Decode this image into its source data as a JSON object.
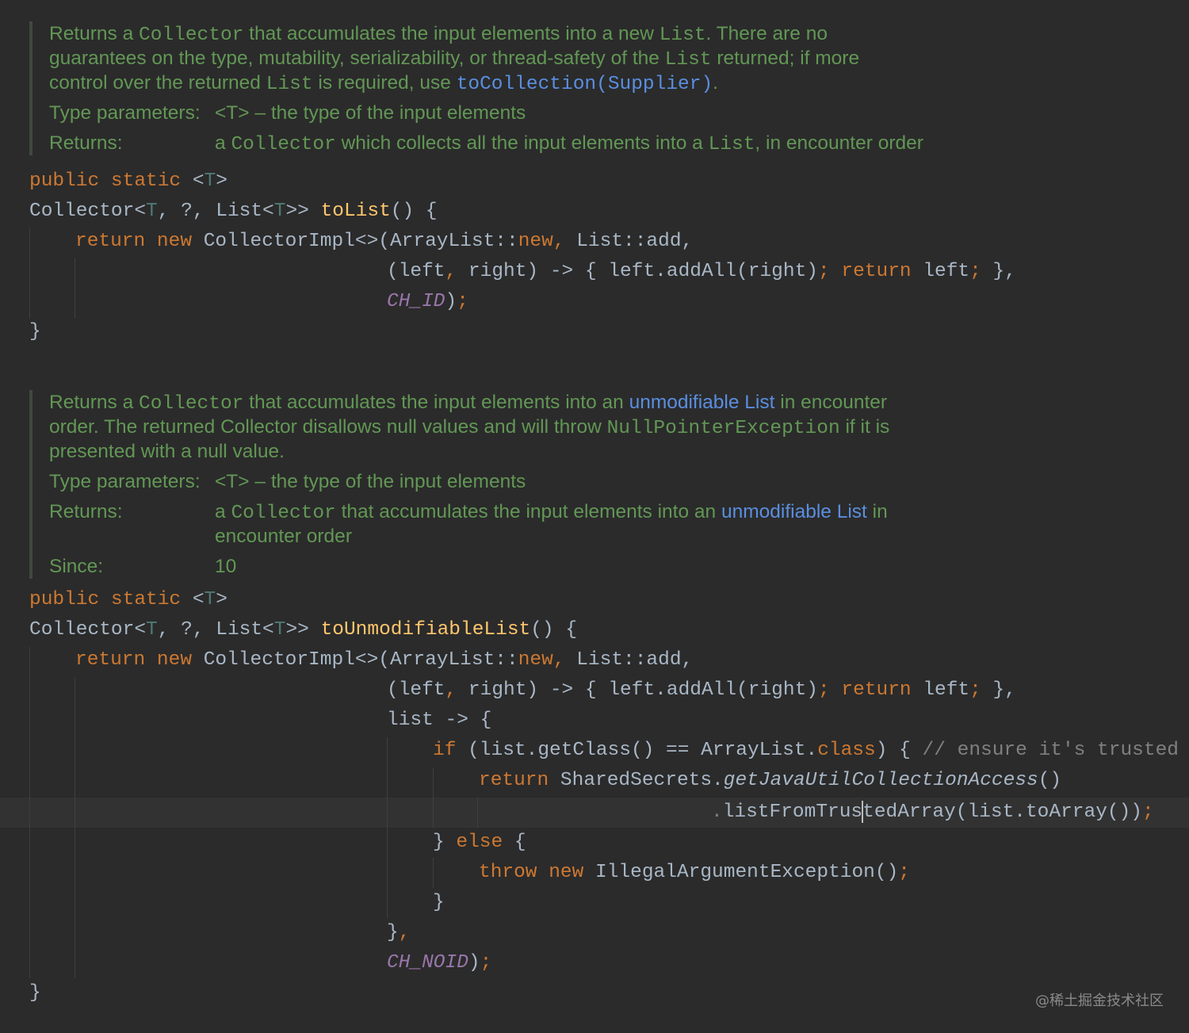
{
  "doc1": {
    "line1": [
      "Returns a ",
      "Collector",
      " that accumulates the input elements into a new ",
      "List",
      ". There are no"
    ],
    "line2": [
      "guarantees on the type, mutability, serializability, or thread-safety of the ",
      "List",
      " returned; if more"
    ],
    "line3": [
      "control over the returned ",
      "List",
      " is required, use ",
      "toCollection(Supplier)",
      "."
    ],
    "type_label": "Type parameters:",
    "type_value": "<T> – the type of the input elements",
    "returns_label": "Returns:",
    "returns_value": [
      "a ",
      "Collector",
      " which collects all the input elements into a ",
      "List",
      ", in encounter order"
    ]
  },
  "code1": {
    "l1": [
      "public",
      "static",
      "<",
      "T",
      ">"
    ],
    "l2": [
      "Collector<",
      "T",
      ", ?, List<",
      "T",
      ">> ",
      "toList",
      "() {"
    ],
    "l3": [
      "return",
      "new",
      "CollectorImpl<>(ArrayList::",
      "new",
      ",",
      " List::add,"
    ],
    "l4": [
      "(left",
      ",",
      " right) -> { left.addAll(right)",
      ";",
      "return",
      "left",
      ";",
      " },"
    ],
    "l5": [
      "CH_ID",
      ")",
      ";"
    ],
    "l6": "}"
  },
  "doc2": {
    "line1": [
      "Returns a ",
      "Collector",
      " that accumulates the input elements into an ",
      "unmodifiable List",
      " in encounter"
    ],
    "line2": [
      "order. The returned Collector disallows null values and will throw ",
      "NullPointerException",
      " if it is"
    ],
    "line3": "presented with a null value.",
    "type_label": "Type parameters:",
    "type_value": "<T> – the type of the input elements",
    "returns_label": "Returns:",
    "returns_value1": [
      "a ",
      "Collector",
      " that accumulates the input elements into an ",
      "unmodifiable List",
      " in"
    ],
    "returns_value2": "encounter order",
    "since_label": "Since:",
    "since_value": "10"
  },
  "code2": {
    "l1": [
      "public",
      "static",
      "<",
      "T",
      ">"
    ],
    "l2": [
      "Collector<",
      "T",
      ", ?, List<",
      "T",
      ">> ",
      "toUnmodifiableList",
      "() {"
    ],
    "l3": [
      "return",
      "new",
      "CollectorImpl<>(ArrayList::",
      "new",
      ",",
      " List::add,"
    ],
    "l4": [
      "(left",
      ",",
      " right) -> { left.addAll(right)",
      ";",
      "return",
      "left",
      ";",
      " },"
    ],
    "l5": "list -> {",
    "l6": [
      "if",
      " (list.getClass() == ArrayList.",
      "class",
      ") { ",
      "// ensure it's trusted"
    ],
    "l7": [
      "return",
      " SharedSecrets.",
      "getJavaUtilCollectionAccess",
      "()"
    ],
    "l8": [
      ".",
      "listFromTrus",
      "tedArray",
      "(list.toArray())",
      ";"
    ],
    "l9": [
      "} ",
      "else",
      " {"
    ],
    "l10": [
      "throw",
      "new",
      " IllegalArgumentException()",
      ";"
    ],
    "l11": "}",
    "l12": [
      "}",
      ","
    ],
    "l13": [
      "CH_NOID",
      ")",
      ";"
    ],
    "l14": "}"
  },
  "watermark": "@稀土掘金技术社区",
  "colors": {
    "background": "#2b2b2b",
    "doc_text": "#629755",
    "link": "#5a8ee0",
    "keyword": "#cc7832",
    "function": "#ffc66d",
    "type_param": "#507874",
    "constant": "#9876aa",
    "comment": "#808080",
    "text": "#a9b7c6"
  }
}
